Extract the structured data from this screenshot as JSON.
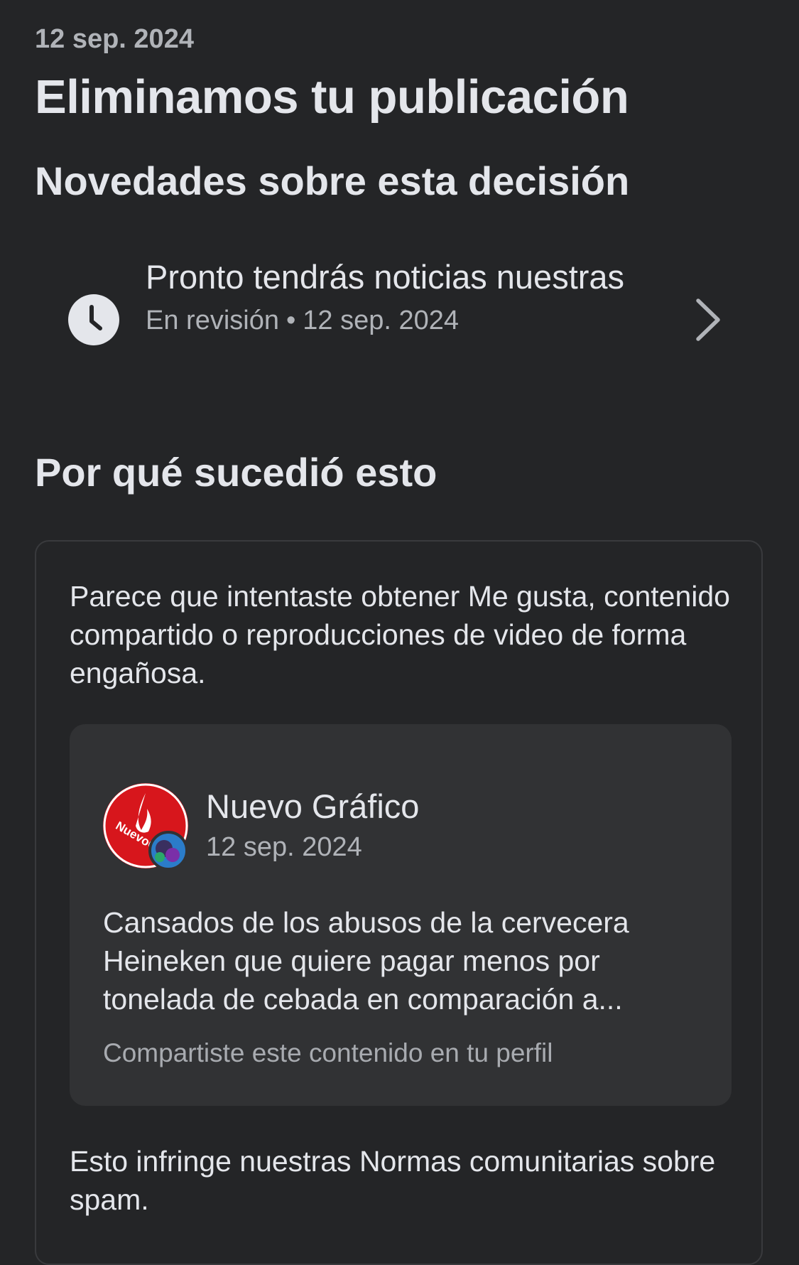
{
  "header": {
    "date": "12 sep. 2024",
    "title": "Eliminamos tu publicación"
  },
  "updates": {
    "heading": "Novedades sobre esta decisión",
    "item": {
      "icon": "clock-icon",
      "title": "Pronto tendrás noticias nuestras",
      "status": "En revisión",
      "separator": "•",
      "date": "12 sep. 2024",
      "chevron": "chevron-right-icon"
    }
  },
  "reason": {
    "heading": "Por qué sucedió esto",
    "explanation": "Parece que intentaste obtener Me gusta, contenido compartido o reproducciones de video de forma engañosa.",
    "post": {
      "author": "Nuevo Gráfico",
      "date": "12 sep. 2024",
      "avatar_logo_text": "NuevoGr",
      "text": "Cansados de los abusos de la cervecera Heineken que quiere pagar  menos por tonelada de cebada en comparación a...",
      "footer": "Compartiste este contenido en tu perfil"
    },
    "violation": "Esto infringe nuestras Normas comunitarias sobre spam."
  },
  "colors": {
    "background": "#242527",
    "primary_text": "#e4e6eb",
    "secondary_text": "#b0b3b8",
    "card_border": "#393a3d",
    "post_card_bg": "#313234",
    "avatar_red": "#d7161c"
  }
}
